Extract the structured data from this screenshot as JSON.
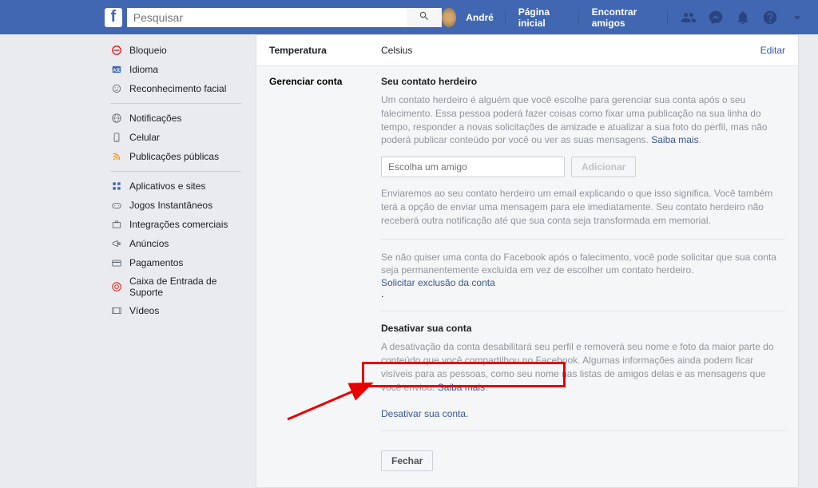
{
  "topbar": {
    "search_placeholder": "Pesquisar",
    "user_name": "André",
    "nav_home": "Página inicial",
    "nav_find_friends": "Encontrar amigos"
  },
  "sidebar": {
    "items": [
      {
        "label": "Bloqueio"
      },
      {
        "label": "Idioma"
      },
      {
        "label": "Reconhecimento facial"
      },
      {
        "label": "Notificações"
      },
      {
        "label": "Celular"
      },
      {
        "label": "Publicações públicas"
      },
      {
        "label": "Aplicativos e sites"
      },
      {
        "label": "Jogos Instantâneos"
      },
      {
        "label": "Integrações comerciais"
      },
      {
        "label": "Anúncios"
      },
      {
        "label": "Pagamentos"
      },
      {
        "label": "Caixa de Entrada de Suporte"
      },
      {
        "label": "Vídeos"
      }
    ]
  },
  "content": {
    "temp_label": "Temperatura",
    "temp_value": "Celsius",
    "edit": "Editar",
    "manage_label": "Gerenciar conta",
    "legacy": {
      "title": "Seu contato herdeiro",
      "desc": "Um contato herdeiro é alguém que você escolhe para gerenciar sua conta após o seu falecimento. Essa pessoa poderá fazer coisas como fixar uma publicação na sua linha do tempo, responder a novas solicitações de amizade e atualizar a sua foto do perfil, mas não poderá publicar conteúdo por você ou ver as suas mensagens. ",
      "learn_more": "Saiba mais",
      "input_placeholder": "Escolha um amigo",
      "add_btn": "Adicionar",
      "email_desc": "Enviaremos ao seu contato herdeiro um email explicando o que isso significa. Você também terá a opção de enviar uma mensagem para ele imediatamente. Seu contato herdeiro não receberá outra notificação até que sua conta seja transformada em memorial.",
      "delete_desc": "Se não quiser uma conta do Facebook após o falecimento, você pode solicitar que sua conta seja permanentemente excluída em vez de escolher um contato herdeiro.",
      "delete_link": "Solicitar exclusão da conta"
    },
    "deactivate": {
      "title": "Desativar sua conta",
      "desc": "A desativação da conta desabilitará seu perfil e removerá seu nome e foto da maior parte do conteúdo que você compartilhou no Facebook. Algumas informações ainda podem ficar visíveis para as pessoas, como seu nome nas listas de amigos delas e as mensagens que você enviou. ",
      "learn_more": "Saiba mais",
      "link": "Desativar sua conta",
      "close": "Fechar"
    }
  }
}
